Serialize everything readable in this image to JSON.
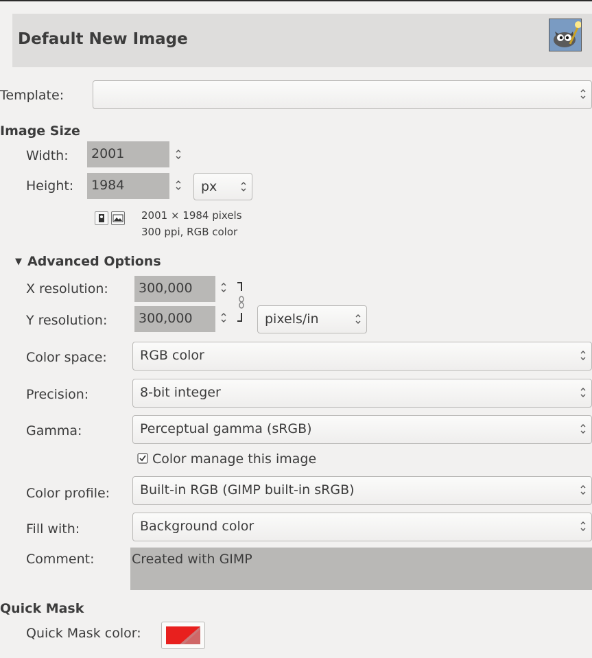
{
  "dialog": {
    "title": "Default New Image"
  },
  "template": {
    "label": "Template:",
    "value": ""
  },
  "image_size": {
    "heading": "Image Size",
    "width_label": "Width:",
    "width_value": "2001",
    "height_label": "Height:",
    "height_value": "1984",
    "unit": "px",
    "info_line1": "2001 × 1984 pixels",
    "info_line2": "300 ppi, RGB color"
  },
  "advanced": {
    "heading": "Advanced Options",
    "xres_label": "X resolution:",
    "xres_value": "300,000",
    "yres_label": "Y resolution:",
    "yres_value": "300,000",
    "res_unit": "pixels/in",
    "colorspace_label": "Color space:",
    "colorspace_value": "RGB color",
    "precision_label": "Precision:",
    "precision_value": "8-bit integer",
    "gamma_label": "Gamma:",
    "gamma_value": "Perceptual gamma (sRGB)",
    "color_manage_label": "Color manage this image",
    "color_manage_checked": true,
    "profile_label": "Color profile:",
    "profile_value": "Built-in RGB (GIMP built-in sRGB)",
    "fill_label": "Fill with:",
    "fill_value": "Background color",
    "comment_label": "Comment:",
    "comment_value": "Created with GIMP"
  },
  "quick_mask": {
    "heading": "Quick Mask",
    "color_label": "Quick Mask color:",
    "color": "#e8201e"
  },
  "icons": [
    "gimp-wilber-icon",
    "portrait-icon",
    "landscape-icon",
    "chain-link-icon",
    "spin-arrows-icon",
    "checkbox-icon"
  ]
}
